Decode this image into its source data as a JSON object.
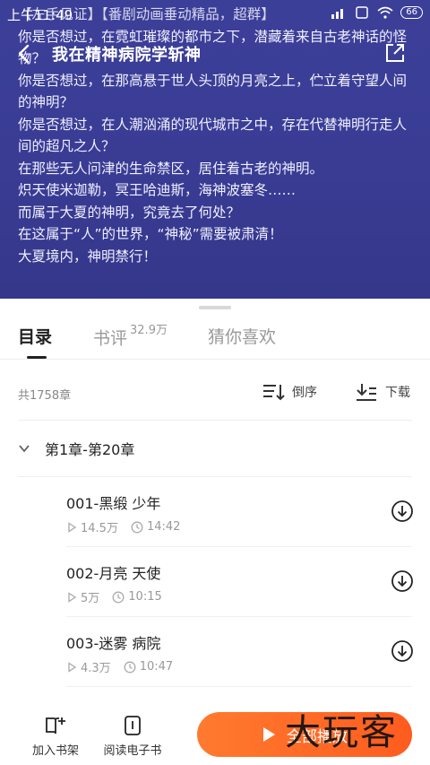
{
  "status": {
    "time": "上午11:49",
    "battery": "66"
  },
  "header": {
    "book_title": "我在精神病院学斩神"
  },
  "intro": {
    "lines": [
      "【左手见证】【番剧动画垂动精品，超群】",
      "你是否想过，在霓虹璀璨的都市之下，潜藏着来自古老神话的怪物？",
      "你是否想过，在那高悬于世人头顶的月亮之上，伫立着守望人间的神明？",
      "你是否想过，在人潮汹涌的现代城市之中，存在代替神明行走人间的超凡之人？",
      "在那些无人问津的生命禁区，居住着古老的神明。",
      "炽天使米迦勒，冥王哈迪斯，海神波塞冬……",
      "而属于大夏的神明，究竟去了何处？",
      "在这属于“人”的世界，“神秘”需要被肃清！",
      "大夏境内，神明禁行！"
    ]
  },
  "tabs": {
    "catalog": "目录",
    "reviews": "书评",
    "reviews_count": "32.9万",
    "recommend": "猜你喜欢"
  },
  "list": {
    "count": "共1758章",
    "sort_label": "倒序",
    "download_label": "下载",
    "volume": "第1章-第20章"
  },
  "chapters": [
    {
      "title": "001-黑缎 少年",
      "plays": "14.5万",
      "duration": "14:42"
    },
    {
      "title": "002-月亮 天使",
      "plays": "5万",
      "duration": "10:15"
    },
    {
      "title": "003-迷雾 病院",
      "plays": "4.3万",
      "duration": "10:47"
    }
  ],
  "bottom": {
    "add_shelf": "加入书架",
    "read_ebook": "阅读电子书",
    "play_all": "全部播放",
    "watermark": "大玩客"
  },
  "colors": {
    "header_bg": "#3a3c94",
    "accent": "#ff6a24"
  }
}
